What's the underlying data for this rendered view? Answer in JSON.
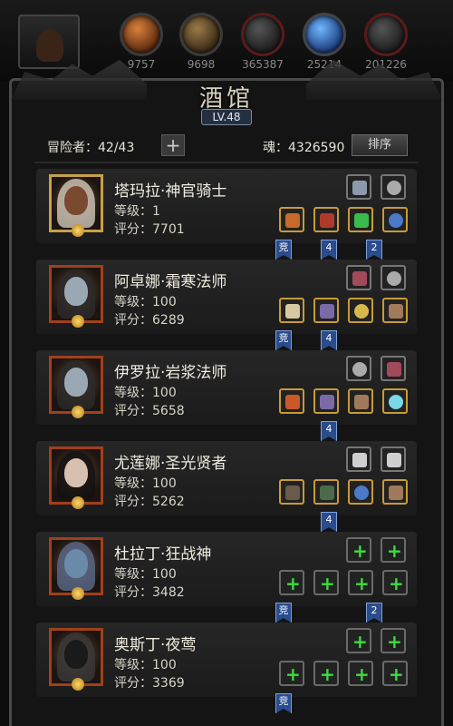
{
  "resources": [
    {
      "value": "9757",
      "icon": "orange-resource-icon",
      "tone": "orange"
    },
    {
      "value": "9698",
      "icon": "wood-resource-icon",
      "tone": "gold"
    },
    {
      "value": "365387",
      "icon": "iron-resource-icon",
      "tone": "red"
    },
    {
      "value": "25214",
      "icon": "crystal-resource-icon",
      "tone": "blue"
    },
    {
      "value": "201226",
      "icon": "stone-resource-icon",
      "tone": "red"
    }
  ],
  "title": "酒馆",
  "level": "LV.48",
  "adventurers_label": "冒险者：42/43",
  "add_label": "+",
  "souls_label": "魂：4326590",
  "sort_label": "排序",
  "heroes": [
    {
      "name": "塔玛拉·神官骑士",
      "level": "等级：1",
      "score": "评分：7701",
      "badges": [
        "竞",
        "4",
        "2"
      ]
    },
    {
      "name": "阿卓娜·霜寒法师",
      "level": "等级：100",
      "score": "评分：6289",
      "badges": [
        "竞",
        "4"
      ]
    },
    {
      "name": "伊罗拉·岩浆法师",
      "level": "等级：100",
      "score": "评分：5658",
      "badges": [
        "4"
      ]
    },
    {
      "name": "尤莲娜·圣光贤者",
      "level": "等级：100",
      "score": "评分：5262",
      "badges": [
        "4"
      ]
    },
    {
      "name": "杜拉丁·狂战神",
      "level": "等级：100",
      "score": "评分：3482",
      "badges": [
        "竞",
        "2"
      ]
    },
    {
      "name": "奥斯丁·夜莺",
      "level": "等级：100",
      "score": "评分：3369",
      "badges": [
        "竞"
      ]
    }
  ]
}
